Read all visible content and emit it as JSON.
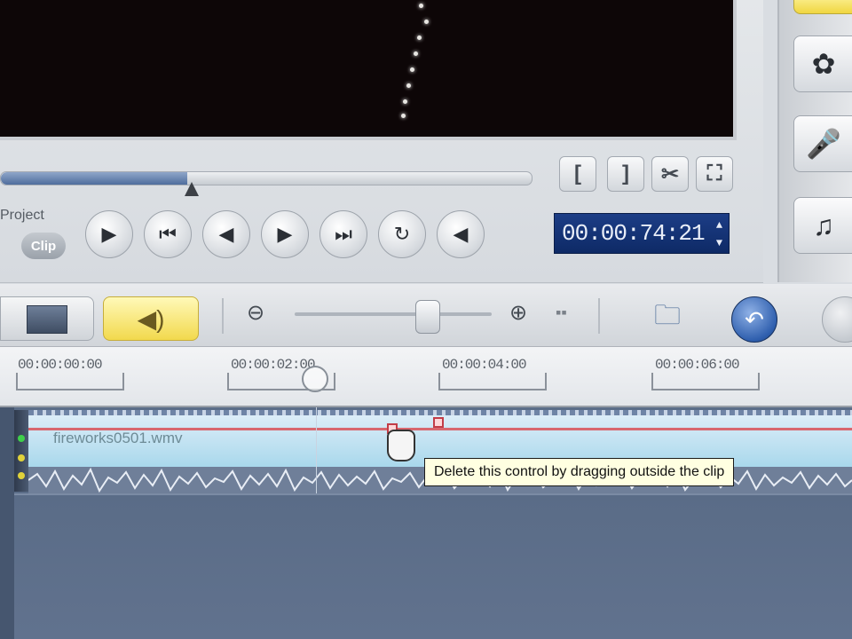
{
  "preview": {
    "project_label": "Project",
    "clip_label": "Clip",
    "scrubber_progress": 0.35,
    "timecode": "00:00:74:21"
  },
  "mark_buttons": [
    {
      "id": "mark-in",
      "glyph": "["
    },
    {
      "id": "mark-out",
      "glyph": "]"
    },
    {
      "id": "split",
      "glyph": "✂"
    },
    {
      "id": "enlarge",
      "glyph": "⛶"
    }
  ],
  "transport_icons": [
    "play-icon",
    "home-icon",
    "previous-frame-icon",
    "next-frame-icon",
    "end-icon",
    "repeat-icon",
    "volume-icon"
  ],
  "side_panel_icons": [
    "film-reel-icon",
    "microphone-icon",
    "music-note-icon"
  ],
  "timeline": {
    "ruler_labels": [
      "00:00:00:00",
      "00:00:02:00",
      "00:00:04:00",
      "00:00:06:00"
    ],
    "clip_name": "fireworks0501.wmv",
    "tooltip": "Delete this control by dragging outside the clip"
  },
  "colors": {
    "accent_yellow": "#f2d94d",
    "timecode_bg": "#1c3d86",
    "timeline_bg": "#5b6d88",
    "audio_clip": "#a9d8ec",
    "volume_line": "#d8676f"
  }
}
